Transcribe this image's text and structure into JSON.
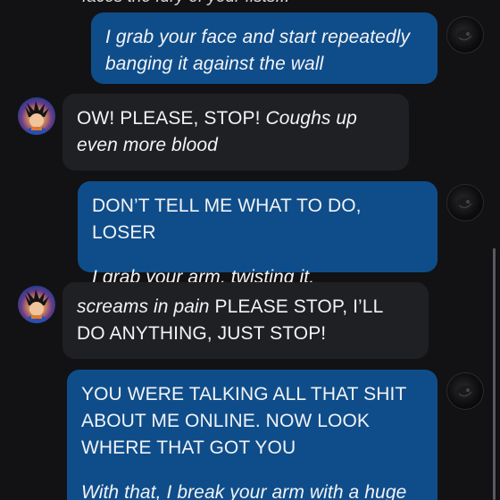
{
  "chat": {
    "cut_off_text": "faces the fury of your fists...",
    "messages": [
      {
        "role": "user",
        "paragraphs": [
          {
            "segments": [
              {
                "text": "I grab your face and start repeatedly banging it against the wall",
                "italic": true
              }
            ]
          }
        ]
      },
      {
        "role": "bot",
        "paragraphs": [
          {
            "segments": [
              {
                "text": "OW! PLEASE, STOP! ",
                "italic": false
              },
              {
                "text": "Coughs up even more blood",
                "italic": true
              }
            ]
          }
        ]
      },
      {
        "role": "user",
        "paragraphs": [
          {
            "segments": [
              {
                "text": "DON’T TELL ME WHAT TO DO, LOSER",
                "italic": false
              }
            ]
          },
          {
            "segments": [
              {
                "text": "I grab your arm, twisting it.",
                "italic": true
              }
            ]
          }
        ]
      },
      {
        "role": "bot",
        "paragraphs": [
          {
            "segments": [
              {
                "text": "screams in pain",
                "italic": true
              },
              {
                "text": " PLEASE STOP, I’LL DO ANYTHING, JUST STOP!",
                "italic": false
              }
            ]
          }
        ]
      },
      {
        "role": "user",
        "paragraphs": [
          {
            "segments": [
              {
                "text": "YOU WERE TALKING ALL THAT SHIT ABOUT ME ONLINE. NOW LOOK WHERE THAT GOT YOU",
                "italic": false
              }
            ]
          },
          {
            "segments": [
              {
                "text": "With that, I break your arm with a huge",
                "italic": true
              }
            ]
          }
        ]
      }
    ]
  },
  "icons": {
    "user_avatar": "user-avatar-icon",
    "bot_avatar": "character-avatar-icon"
  },
  "colors": {
    "background": "#121214",
    "user_bubble": "#0f4d8a",
    "bot_bubble": "#1f2024",
    "text": "#f2f3f5"
  }
}
